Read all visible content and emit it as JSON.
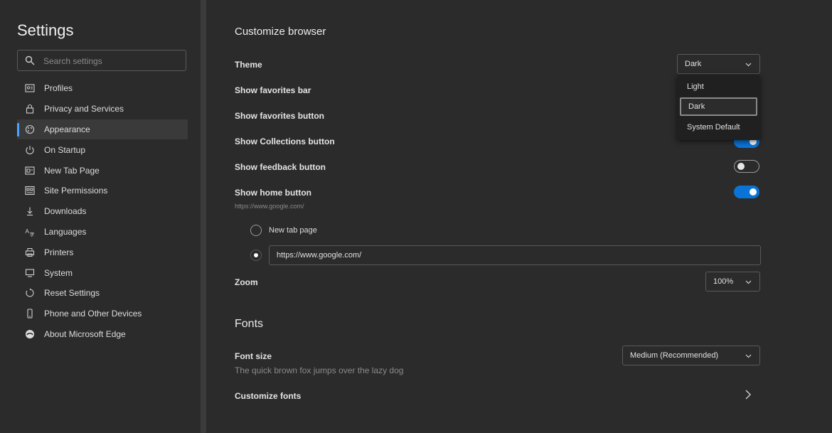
{
  "sidebar": {
    "title": "Settings",
    "search_placeholder": "Search settings",
    "items": [
      {
        "label": "Profiles",
        "icon": "profile-icon"
      },
      {
        "label": "Privacy and Services",
        "icon": "lock-icon"
      },
      {
        "label": "Appearance",
        "icon": "appearance-icon",
        "active": true
      },
      {
        "label": "On Startup",
        "icon": "power-icon"
      },
      {
        "label": "New Tab Page",
        "icon": "newtab-icon"
      },
      {
        "label": "Site Permissions",
        "icon": "permissions-icon"
      },
      {
        "label": "Downloads",
        "icon": "download-icon"
      },
      {
        "label": "Languages",
        "icon": "language-icon"
      },
      {
        "label": "Printers",
        "icon": "printer-icon"
      },
      {
        "label": "System",
        "icon": "system-icon"
      },
      {
        "label": "Reset Settings",
        "icon": "reset-icon"
      },
      {
        "label": "Phone and Other Devices",
        "icon": "phone-icon"
      },
      {
        "label": "About Microsoft Edge",
        "icon": "edge-icon"
      }
    ]
  },
  "main": {
    "customize_title": "Customize browser",
    "theme": {
      "label": "Theme",
      "value": "Dark",
      "options": [
        "Light",
        "Dark",
        "System Default"
      ],
      "selected": "Dark"
    },
    "toggles": {
      "favorites_bar": {
        "label": "Show favorites bar"
      },
      "favorites_button": {
        "label": "Show favorites button"
      },
      "collections_button": {
        "label": "Show Collections button",
        "on": true
      },
      "feedback_button": {
        "label": "Show feedback button",
        "on": false
      },
      "home_button": {
        "label": "Show home button",
        "sub": "https://www.google.com/",
        "on": true
      }
    },
    "home_options": {
      "new_tab_label": "New tab page",
      "url_value": "https://www.google.com/"
    },
    "zoom": {
      "label": "Zoom",
      "value": "100%"
    },
    "fonts_title": "Fonts",
    "font_size": {
      "label": "Font size",
      "value": "Medium (Recommended)",
      "sample": "The quick brown fox jumps over the lazy dog"
    },
    "customize_fonts_label": "Customize fonts"
  },
  "colors": {
    "accent": "#0a74d6",
    "background": "#2b2b2b",
    "active_indicator": "#4da3ff"
  }
}
